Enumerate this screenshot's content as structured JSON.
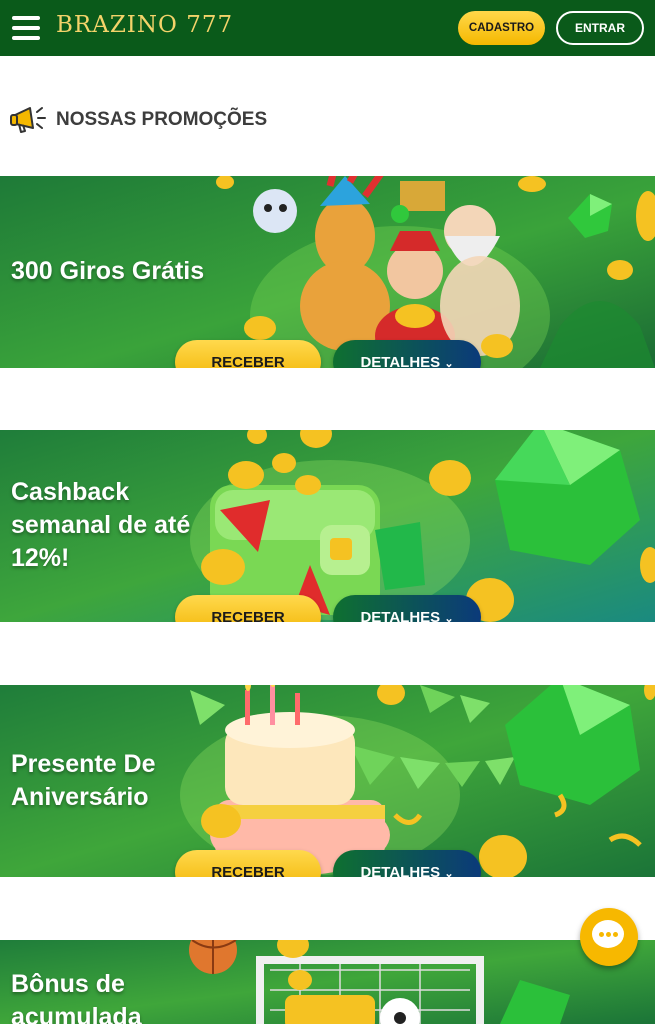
{
  "header": {
    "logo": "BRAZINO 777",
    "cadastro_label": "CADASTRO",
    "entrar_label": "ENTRAR"
  },
  "section": {
    "title": "NOSSAS PROMOÇÕES",
    "icon": "megaphone-icon"
  },
  "promotions": [
    {
      "title_lines": [
        "300 Giros Grátis"
      ],
      "receber_label": "RECEBER",
      "detalhes_label": "DETALHES"
    },
    {
      "title_lines": [
        "Cashback",
        "semanal de até",
        "12%!"
      ],
      "receber_label": "RECEBER",
      "detalhes_label": "DETALHES"
    },
    {
      "title_lines": [
        "Presente De",
        "Aniversário"
      ],
      "receber_label": "RECEBER",
      "detalhes_label": "DETALHES"
    },
    {
      "title_lines": [
        "Bônus de",
        "acumulada"
      ]
    }
  ],
  "chat": {
    "icon": "chat-icon"
  },
  "colors": {
    "header_bg": "#0a5a1a",
    "banner_green": "#1f8a3a",
    "button_yellow": "#f5b800",
    "details_gradient_end": "#0b3a7a",
    "gem_green": "#2ecc40"
  }
}
